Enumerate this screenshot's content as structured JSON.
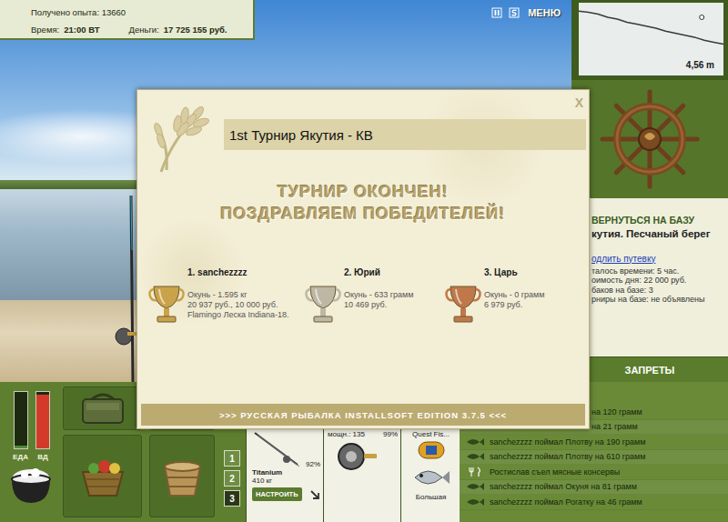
{
  "hud": {
    "experience": "Получено опыта: 13660",
    "time_label": "Время:",
    "time": "21:00 ВТ",
    "money_label": "Деньги:",
    "money": "17 725 155 руб."
  },
  "toolbar": {
    "menu": "МЕНЮ"
  },
  "depth": {
    "reading": "4,56 m",
    "profile": [
      0.3,
      0.4,
      0.6,
      0.9,
      1.1,
      1.4,
      1.6,
      1.8,
      2.0,
      2.3,
      2.5,
      2.7,
      2.9,
      3.2,
      3.4,
      3.6
    ],
    "marker": {
      "level": 0.85
    }
  },
  "base_panel": {
    "title": "ВЕРНУТЬСЯ НА БАЗУ",
    "location": "кутия. Песчаный берег",
    "link": "одлить путевку",
    "lines": [
      "талось времени: 5 час.",
      "оимость дня: 22 000 руб.",
      "баков на базе: 3",
      "рниры на базе: не объявлены"
    ]
  },
  "bans": "ЗАПРЕТЫ",
  "log": [
    {
      "text": "на 120 грамм",
      "kind": "partial"
    },
    {
      "text": "на 21 грамм",
      "kind": "partial"
    },
    {
      "text": "sanchezzzz поймал Плотву на 190 грамм",
      "kind": "catch"
    },
    {
      "text": "sanchezzzz поймал Плотву на 610 грамм",
      "kind": "catch"
    },
    {
      "text": "Ростислав съел мясные консервы",
      "kind": "eat"
    },
    {
      "text": "sanchezzzz поймал Окуня на 81 грамм",
      "kind": "catch"
    },
    {
      "text": "sanchezzzz поймал Рогатку на 46 грамм",
      "kind": "catch"
    }
  ],
  "meters": [
    {
      "label": "ЕДА",
      "level": 0.05
    },
    {
      "label": "ВД",
      "level": 0.95
    }
  ],
  "slots": [
    {
      "label": "1",
      "selected": false
    },
    {
      "label": "2",
      "selected": false
    },
    {
      "label": "3",
      "selected": true
    }
  ],
  "rod": {
    "name": "Titanium",
    "weight": "410 кг",
    "wear": "92%",
    "button": "НАСТРОИТЬ"
  },
  "reel": {
    "power": "мощн.: 135",
    "wear": "99%"
  },
  "line": {
    "name": "Quest Fis..."
  },
  "lure": {
    "name": "Большая"
  },
  "modal": {
    "title": "1st Турнир Якутия - КВ",
    "close": "X",
    "headline": [
      "ТУРНИР ОКОНЧЕН!",
      "ПОЗДРАВЛЯЕМ ПОБЕДИТЕЛЕЙ!"
    ],
    "winners": [
      {
        "name": "1. sanchezzzz",
        "fish": "Окунь - 1.595 кг",
        "prize": "20 937 руб., 10 000 руб.",
        "item": "Flamingo Леска Indiana-18.",
        "color": "#c9a24a"
      },
      {
        "name": "2. Юрий",
        "fish": "Окунь - 633 грамм",
        "prize": "10 469 руб.",
        "color": "#bdb7a4"
      },
      {
        "name": "3. Царь",
        "fish": "Окунь - 0 грамм",
        "prize": "6 979 руб.",
        "color": "#c0784a"
      }
    ],
    "footer": ">>> РУССКАЯ РЫБАЛКА INSTALLSOFT EDITION 3.7.5 <<<"
  }
}
